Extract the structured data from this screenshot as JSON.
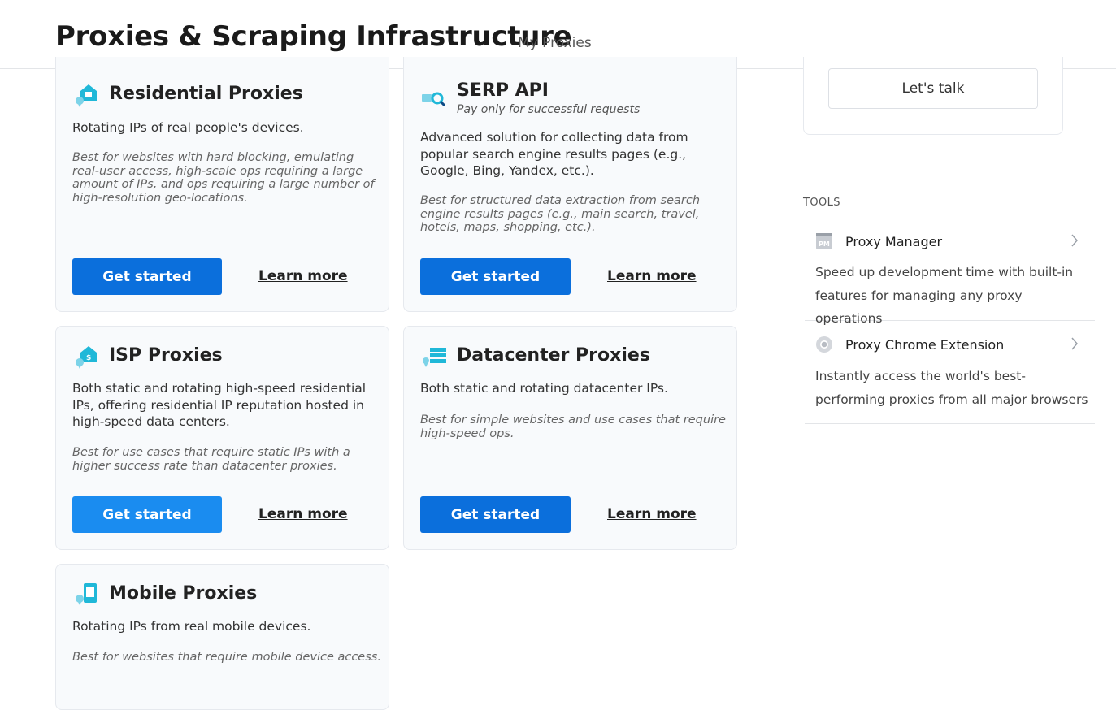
{
  "header": {
    "title": "Proxies & Scraping Infrastructure",
    "subtitle": "My Proxies"
  },
  "products": [
    {
      "title": "Residential Proxies",
      "description": "Rotating IPs of real people's devices.",
      "note": "Best for websites with hard blocking, emulating real-user access, high-scale ops requiring a large amount of IPs, and ops requiring a large number of high-resolution geo-locations.",
      "primary": "Get started",
      "secondary": "Learn more",
      "icon": "house-pin-icon"
    },
    {
      "title": "SERP API",
      "tagline": "Pay only for successful requests",
      "description": "Advanced solution for collecting data from popular search engine results pages (e.g., Google, Bing, Yandex, etc.).",
      "note": "Best for structured data extraction from search engine results pages (e.g., main search, travel, hotels, maps, shopping, etc.).",
      "primary": "Get started",
      "secondary": "Learn more",
      "icon": "search-results-icon"
    },
    {
      "title": "ISP Proxies",
      "description": "Both static and rotating high-speed residential IPs, offering residential IP reputation hosted in high-speed data centers.",
      "note": "Best for use cases that require static IPs with a higher success rate than datacenter proxies.",
      "primary": "Get started",
      "secondary": "Learn more",
      "icon": "house-dollar-icon"
    },
    {
      "title": "Datacenter Proxies",
      "description": "Both static and rotating datacenter IPs.",
      "note": "Best for simple websites and use cases that require high-speed ops.",
      "primary": "Get started",
      "secondary": "Learn more",
      "icon": "server-stack-icon"
    },
    {
      "title": "Mobile Proxies",
      "description": "Rotating IPs from real mobile devices.",
      "note": "Best for websites that require mobile device access.",
      "icon": "mobile-device-icon"
    }
  ],
  "sidebar": {
    "talk_label": "Let's talk",
    "tools_heading": "TOOLS",
    "tools": [
      {
        "name": "Proxy Manager",
        "description": "Speed up development time with built-in features for managing any proxy operations",
        "icon": "proxy-manager-icon"
      },
      {
        "name": "Proxy Chrome Extension",
        "description": "Instantly access the world's best-performing proxies from all major browsers",
        "icon": "chrome-icon"
      }
    ]
  },
  "colors": {
    "primary_button": "#0b6fdc",
    "primary_button_light": "#1a8cf0",
    "icon_teal": "#20b8d8",
    "icon_navy": "#0d4a85",
    "card_background": "#f8fafc"
  }
}
